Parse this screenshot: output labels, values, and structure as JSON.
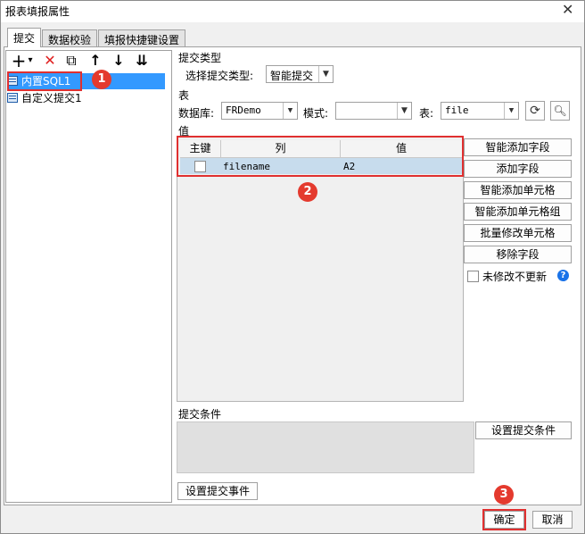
{
  "window": {
    "title": "报表填报属性",
    "close_icon": "close-icon"
  },
  "tabs": [
    {
      "label": "提交",
      "active": true
    },
    {
      "label": "数据校验",
      "active": false
    },
    {
      "label": "填报快捷键设置",
      "active": false
    }
  ],
  "toolbar": {
    "add": "+",
    "add_arrow": "▾",
    "delete": "✕",
    "copy": "⧉",
    "up": "↑",
    "down": "↓",
    "more": "⇊"
  },
  "tree": {
    "items": [
      {
        "label": "内置SQL1",
        "selected": true
      },
      {
        "label": "自定义提交1",
        "selected": false
      }
    ]
  },
  "submit_type": {
    "section_label": "提交类型",
    "select_label": "选择提交类型:",
    "value": "智能提交"
  },
  "table_section": {
    "section_label": "表",
    "db_label": "数据库:",
    "db_value": "FRDemo",
    "schema_label": "模式:",
    "schema_value": "",
    "table_label": "表:",
    "table_value": "file"
  },
  "values_section": {
    "section_label": "值",
    "columns": [
      "主键",
      "列",
      "值"
    ],
    "rows": [
      {
        "key": false,
        "column": "filename",
        "value": "A2"
      }
    ]
  },
  "right_buttons": {
    "smart_add_field": "智能添加字段",
    "add_field": "添加字段",
    "smart_add_cell": "智能添加单元格",
    "smart_add_cell_group": "智能添加单元格组",
    "batch_modify_cell": "批量修改单元格",
    "remove_field": "移除字段",
    "no_update_label": "未修改不更新",
    "help": "?"
  },
  "condition_section": {
    "section_label": "提交条件",
    "set_condition": "设置提交条件",
    "set_event": "设置提交事件"
  },
  "footer": {
    "ok": "确定",
    "cancel": "取消"
  },
  "badges": [
    "1",
    "2",
    "3"
  ],
  "colors": {
    "selection": "#3399ff",
    "highlight": "#e03030",
    "badge": "#e43a2e"
  }
}
